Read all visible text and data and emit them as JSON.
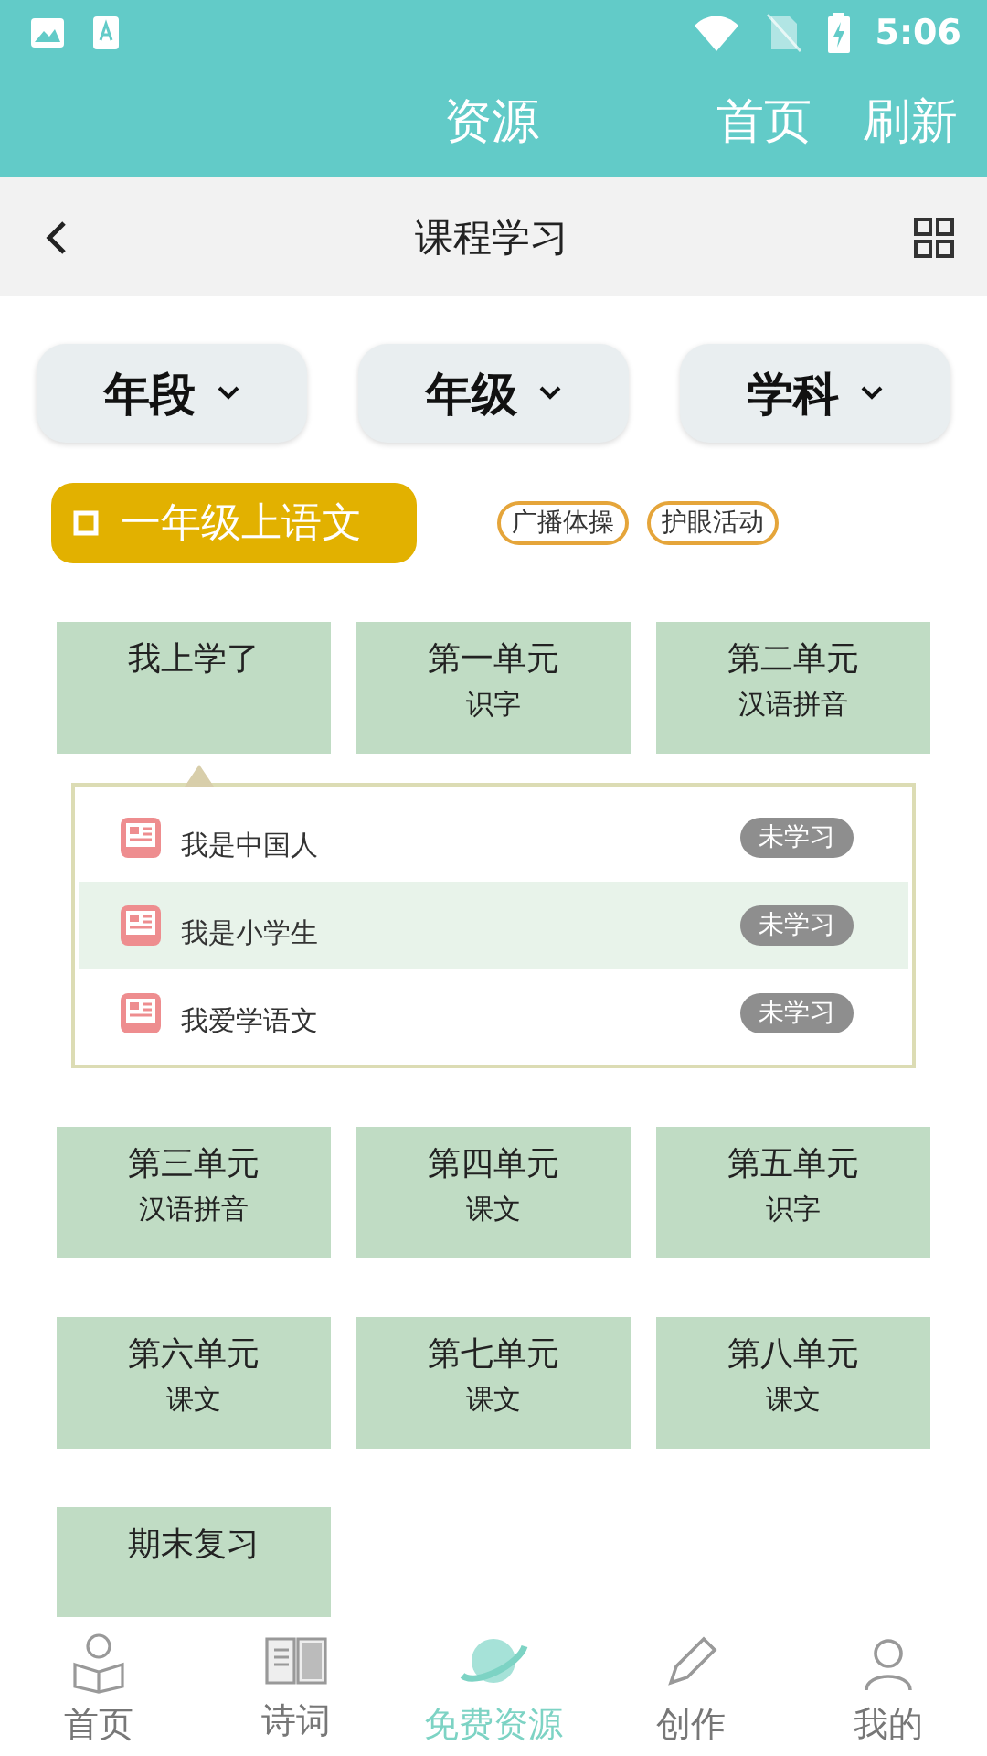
{
  "status_bar": {
    "time": "5:06"
  },
  "app_bar": {
    "title": "资源",
    "actions": [
      "首页",
      "刷新"
    ]
  },
  "nav_bar": {
    "title": "课程学习"
  },
  "filters": [
    {
      "label": "年段"
    },
    {
      "label": "年级"
    },
    {
      "label": "学科"
    }
  ],
  "book": {
    "label": "一年级上语文"
  },
  "tags": [
    "广播体操",
    "护眼活动"
  ],
  "units": [
    {
      "title": "我上学了",
      "expanded": true,
      "lessons": [
        {
          "title": "我是中国人",
          "status": "未学习",
          "selected": false
        },
        {
          "title": "我是小学生",
          "status": "未学习",
          "selected": true
        },
        {
          "title": "我爱学语文",
          "status": "未学习",
          "selected": false
        }
      ]
    },
    {
      "title": "第一单元",
      "subtitle": "识字"
    },
    {
      "title": "第二单元",
      "subtitle": "汉语拼音"
    },
    {
      "title": "第三单元",
      "subtitle": "汉语拼音"
    },
    {
      "title": "第四单元",
      "subtitle": "课文"
    },
    {
      "title": "第五单元",
      "subtitle": "识字"
    },
    {
      "title": "第六单元",
      "subtitle": "课文"
    },
    {
      "title": "第七单元",
      "subtitle": "课文"
    },
    {
      "title": "第八单元",
      "subtitle": "课文"
    },
    {
      "title": "期末复习"
    }
  ],
  "tab_bar": [
    {
      "label": "首页",
      "selected": false
    },
    {
      "label": "诗词",
      "selected": false
    },
    {
      "label": "免费资源",
      "selected": true
    },
    {
      "label": "创作",
      "selected": false
    },
    {
      "label": "我的",
      "selected": false
    }
  ]
}
